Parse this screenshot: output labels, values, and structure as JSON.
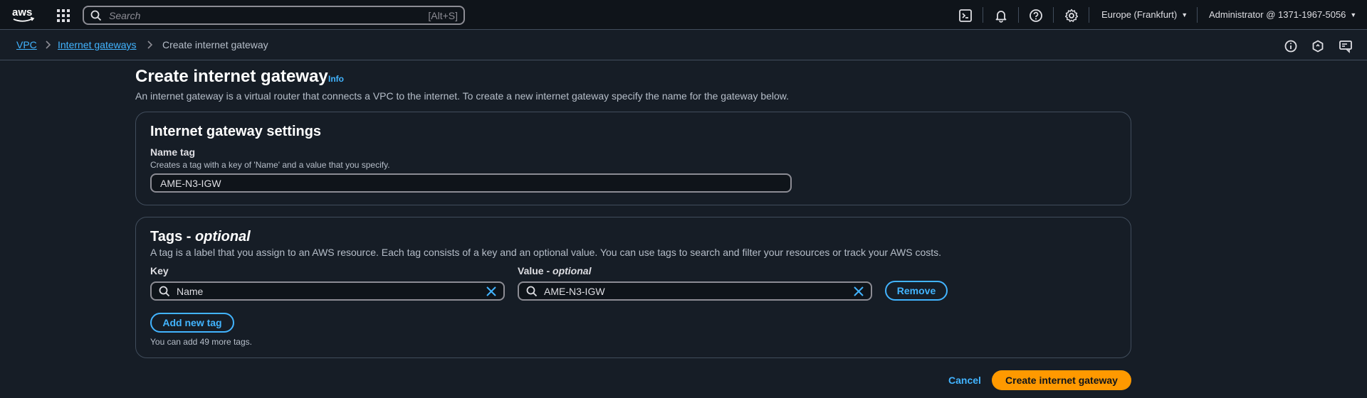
{
  "topnav": {
    "logo_text": "aws",
    "search": {
      "placeholder": "Search",
      "shortcut": "[Alt+S]"
    },
    "icons": [
      "cloudshell-icon",
      "bell-icon",
      "help-icon",
      "gear-icon"
    ],
    "region": "Europe (Frankfurt)",
    "account": "Administrator @ 1371-1967-5056"
  },
  "breadcrumb": {
    "items": [
      "VPC",
      "Internet gateways",
      "Create internet gateway"
    ]
  },
  "header": {
    "title": "Create internet gateway",
    "info": "Info",
    "description": "An internet gateway is a virtual router that connects a VPC to the internet. To create a new internet gateway specify the name for the gateway below."
  },
  "settings": {
    "title": "Internet gateway settings",
    "name_tag_label": "Name tag",
    "name_tag_hint": "Creates a tag with a key of 'Name' and a value that you specify.",
    "name_tag_value": "AME-N3-IGW"
  },
  "tags": {
    "title_main": "Tags - ",
    "title_optional": "optional",
    "description": "A tag is a label that you assign to an AWS resource. Each tag consists of a key and an optional value. You can use tags to search and filter your resources or track your AWS costs.",
    "key_label": "Key",
    "value_label_main": "Value - ",
    "value_label_optional": "optional",
    "rows": [
      {
        "key": "Name",
        "value": "AME-N3-IGW"
      }
    ],
    "remove_label": "Remove",
    "add_label": "Add new tag",
    "remaining_hint": "You can add 49 more tags."
  },
  "actions": {
    "cancel": "Cancel",
    "create": "Create internet gateway"
  },
  "colors": {
    "background": "#161d26",
    "accent": "#42b4ff",
    "primary": "#ff9900"
  }
}
